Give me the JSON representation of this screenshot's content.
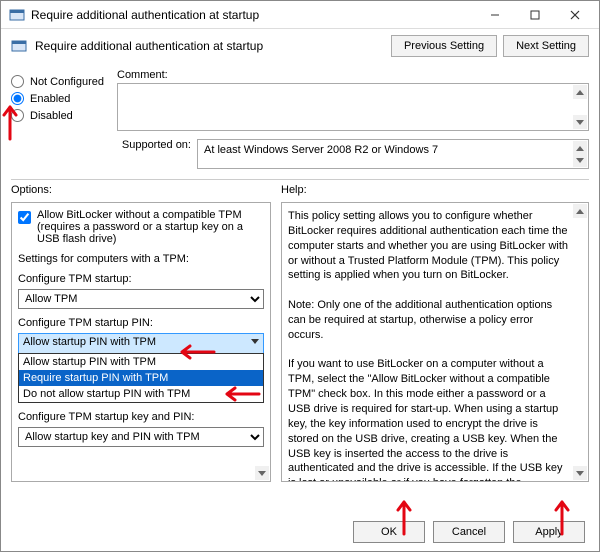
{
  "window": {
    "title": "Require additional authentication at startup"
  },
  "header": {
    "title": "Require additional authentication at startup",
    "prev_btn": "Previous Setting",
    "next_btn": "Next Setting"
  },
  "state": {
    "not_configured": "Not Configured",
    "enabled": "Enabled",
    "disabled": "Disabled",
    "selected": "enabled"
  },
  "comment": {
    "label": "Comment:",
    "value": ""
  },
  "supported": {
    "label": "Supported on:",
    "value": "At least Windows Server 2008 R2 or Windows 7"
  },
  "options": {
    "label": "Options:",
    "allow_no_tpm_checkbox": "Allow BitLocker without a compatible TPM (requires a password or a startup key on a USB flash drive)",
    "allow_no_tpm_checked": true,
    "section_label": "Settings for computers with a TPM:",
    "tpm_startup_label": "Configure TPM startup:",
    "tpm_startup_value": "Allow TPM",
    "tpm_pin_label": "Configure TPM startup PIN:",
    "tpm_pin_selected": "Allow startup PIN with TPM",
    "tpm_pin_options": [
      "Allow startup PIN with TPM",
      "Require startup PIN with TPM",
      "Do not allow startup PIN with TPM"
    ],
    "tpm_pin_highlighted_index": 1,
    "tpm_key_label": "Configure TPM startup key and PIN:",
    "tpm_key_value": "Allow startup key and PIN with TPM"
  },
  "help": {
    "label": "Help:",
    "text": "This policy setting allows you to configure whether BitLocker requires additional authentication each time the computer starts and whether you are using BitLocker with or without a Trusted Platform Module (TPM). This policy setting is applied when you turn on BitLocker.\n\nNote: Only one of the additional authentication options can be required at startup, otherwise a policy error occurs.\n\nIf you want to use BitLocker on a computer without a TPM, select the \"Allow BitLocker without a compatible TPM\" check box. In this mode either a password or a USB drive is required for start-up. When using a startup key, the key information used to encrypt the drive is stored on the USB drive, creating a USB key. When the USB key is inserted the access to the drive is authenticated and the drive is accessible. If the USB key is lost or unavailable or if you have forgotten the password then you will need to use one of the BitLocker recovery options to access the drive.\n\nOn a computer with a compatible TPM, four types of"
  },
  "buttons": {
    "ok": "OK",
    "cancel": "Cancel",
    "apply": "Apply"
  }
}
